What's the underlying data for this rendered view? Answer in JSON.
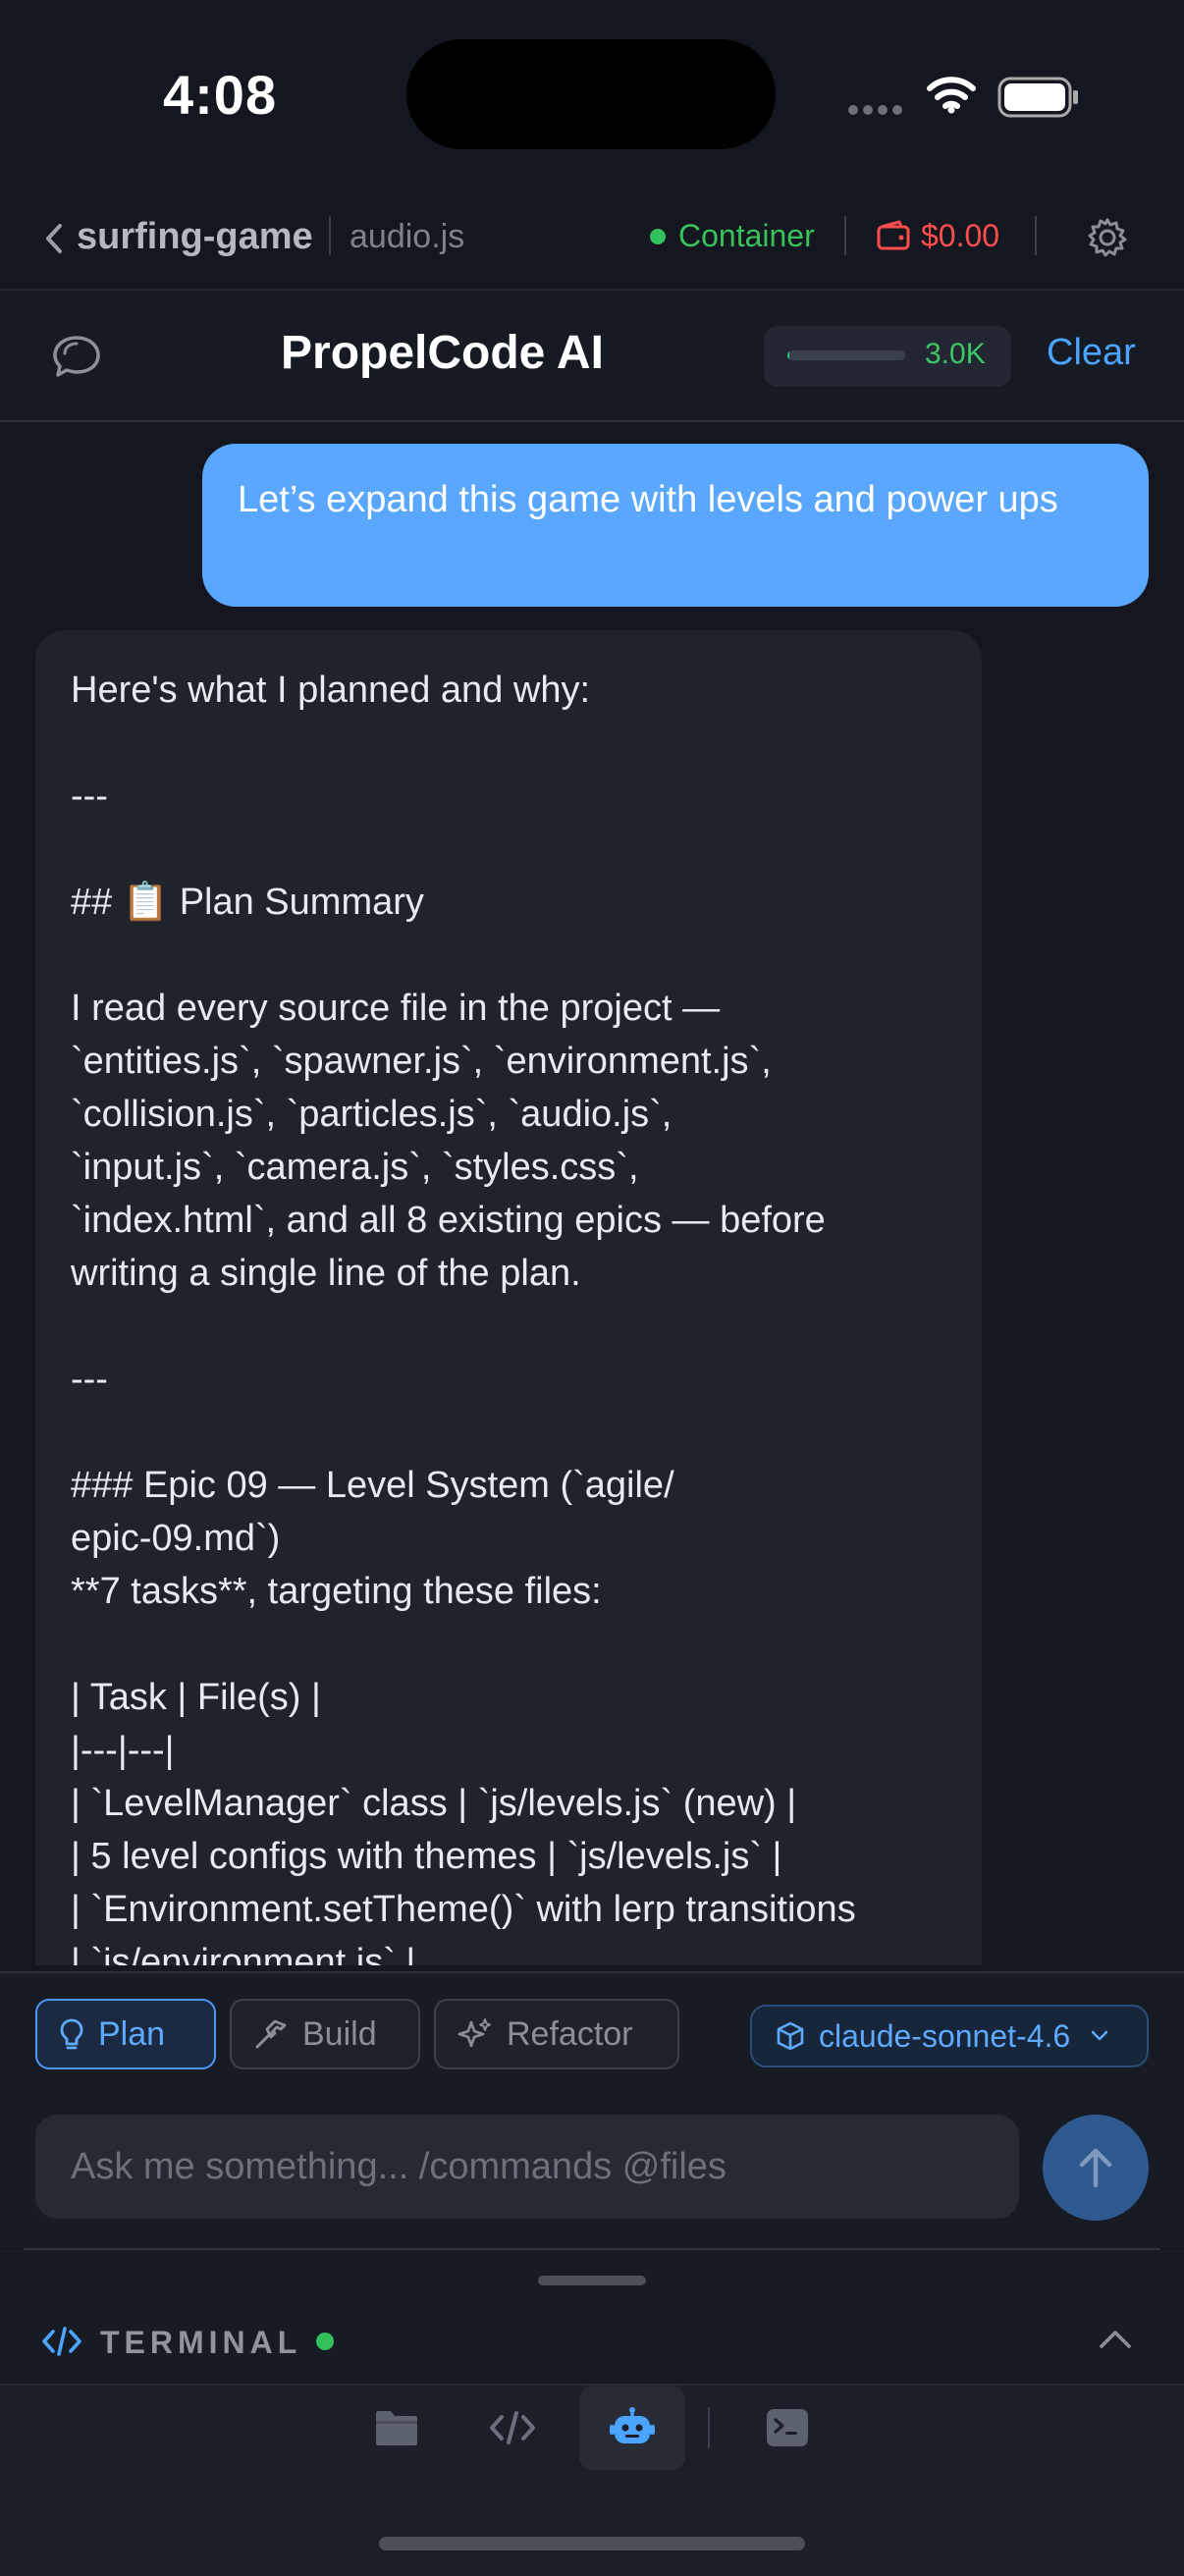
{
  "status_bar": {
    "time": "4:08",
    "icons": [
      "signal-dots-icon",
      "wifi-icon",
      "battery-icon"
    ]
  },
  "nav": {
    "project": "surfing-game",
    "file": "audio.js",
    "container_label": "Container",
    "cost": "$0.00"
  },
  "chat_header": {
    "title": "PropelCode AI",
    "token_count": "3.0K",
    "token_usage_fraction": 0.02,
    "clear_label": "Clear"
  },
  "messages": {
    "user": "Let’s expand this game with levels and power ups",
    "assistant": "Here's what I planned and why:\n\n---\n\n## 📋 Plan Summary\n\nI read every source file in the project —\n`entities.js`, `spawner.js`, `environment.js`,\n`collision.js`, `particles.js`, `audio.js`,\n`input.js`, `camera.js`, `styles.css`,\n`index.html`, and all 8 existing epics — before\nwriting a single line of the plan.\n\n---\n\n### Epic 09 — Level System (`agile/\nepic-09.md`)\n**7 tasks**, targeting these files:\n\n| Task | File(s) |\n|---|---|\n| `LevelManager` class | `js/levels.js` (new) |\n| 5 level configs with themes | `js/levels.js` |\n| `Environment.setTheme()` with lerp transitions\n| `js/environment.js` |"
  },
  "modes": [
    {
      "label": "Plan",
      "active": true
    },
    {
      "label": "Build",
      "active": false
    },
    {
      "label": "Refactor",
      "active": false
    }
  ],
  "model": "claude-sonnet-4.6",
  "input": {
    "placeholder": "Ask me something... /commands @files",
    "value": ""
  },
  "terminal": {
    "label": "TERMINAL",
    "status": "running"
  },
  "tabs": [
    {
      "name": "files-icon",
      "active": false
    },
    {
      "name": "code-icon",
      "active": false
    },
    {
      "name": "bot-icon",
      "active": true
    },
    {
      "name": "terminal-icon",
      "active": false
    }
  ],
  "colors": {
    "accent": "#4ba4ff",
    "user_bubble": "#5aa7ff",
    "success": "#32c15b",
    "danger": "#ff4d4d",
    "background": "#14171f"
  }
}
